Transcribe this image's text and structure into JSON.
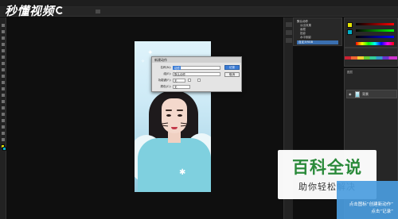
{
  "watermark_logo": {
    "text": "秒懂视频"
  },
  "brand": {
    "title": "百科全说",
    "subtitle": "助你轻松解决"
  },
  "dialog": {
    "title": "新建动作",
    "fields": [
      {
        "label": "名称(N):",
        "value": "动作1"
      },
      {
        "label": "组(E):",
        "value": "默认动作"
      },
      {
        "label": "功能键(F):",
        "value": "无"
      },
      {
        "label": "颜色(C):",
        "value": "无"
      }
    ],
    "buttons": {
      "ok": "记录",
      "cancel": "取消"
    }
  },
  "history": {
    "items": [
      {
        "label": "默认动作"
      },
      {
        "label": "淡出效果"
      },
      {
        "label": "画框"
      },
      {
        "label": "投影"
      },
      {
        "label": "水中倒影"
      },
      {
        "label": "自定义RGB"
      }
    ]
  },
  "layers": {
    "tab": "图层",
    "layer_name": "背景"
  },
  "hint": {
    "line1": "点击图标“创建新动作”",
    "line2": "点击“记录”"
  },
  "colors": {
    "accent": "#3a7bd5",
    "brand_green": "#2a8a3a",
    "hint_blue": "#4a9cde"
  }
}
